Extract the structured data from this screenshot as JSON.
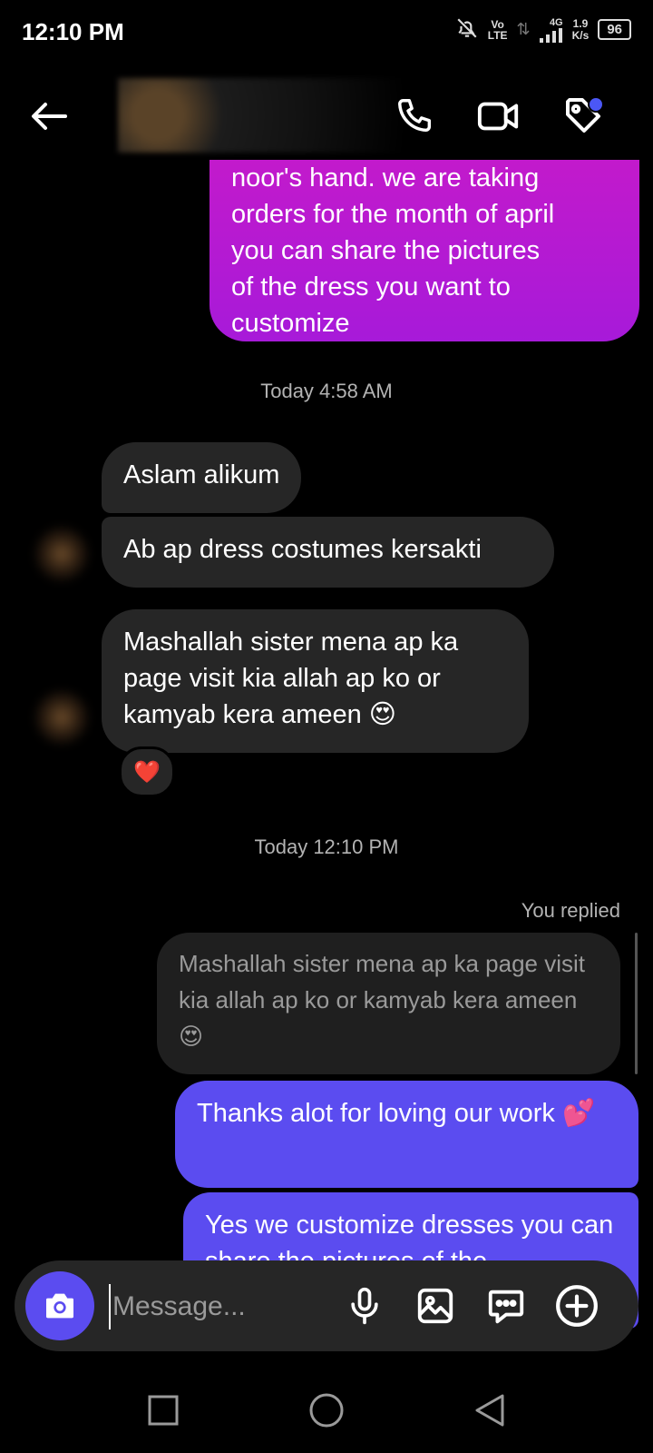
{
  "status_bar": {
    "time": "12:10 PM",
    "volte_top": "Vo",
    "volte_bottom": "LTE",
    "network": "4G",
    "speed_value": "1.9",
    "speed_unit": "K/s",
    "battery": "96"
  },
  "header": {
    "icons": [
      "back-arrow-icon",
      "phone-icon",
      "video-camera-icon",
      "tag-icon"
    ],
    "notification_dot_color": "#4b57f5"
  },
  "messages": {
    "outgoing_1_lines": [
      "noor's hand. we are taking",
      "orders for the month of april",
      "you can share the pictures",
      "of the dress you want to",
      "customize"
    ],
    "timestamp_1": "Today 4:58 AM",
    "incoming_1": "Aslam alikum",
    "incoming_2": "Ab ap dress costumes kersakti",
    "incoming_3": "Mashallah sister mena ap ka page visit kia allah ap ko or kamyab kera ameen 😍",
    "reaction": "❤️",
    "timestamp_2": "Today 12:10 PM",
    "you_replied": "You replied",
    "quoted": "Mashallah sister mena ap ka page visit kia allah ap ko or kamyab kera ameen 😍",
    "outgoing_2": "Thanks alot for loving our work 💕",
    "outgoing_3": "Yes we customize dresses you can share the pictures of the"
  },
  "composer": {
    "placeholder": "Message...",
    "icons": [
      "camera-icon",
      "microphone-icon",
      "gallery-icon",
      "sticker-chat-icon",
      "plus-circle-icon"
    ]
  },
  "navbar": {
    "icons": [
      "recents-square-icon",
      "home-circle-icon",
      "back-triangle-icon"
    ]
  },
  "colors": {
    "outgoing_gradient_top": "#c71ac9",
    "outgoing_gradient_bottom": "#a71ad9",
    "outgoing_blue": "#5b4cf0",
    "incoming": "#262626",
    "background": "#000000"
  }
}
